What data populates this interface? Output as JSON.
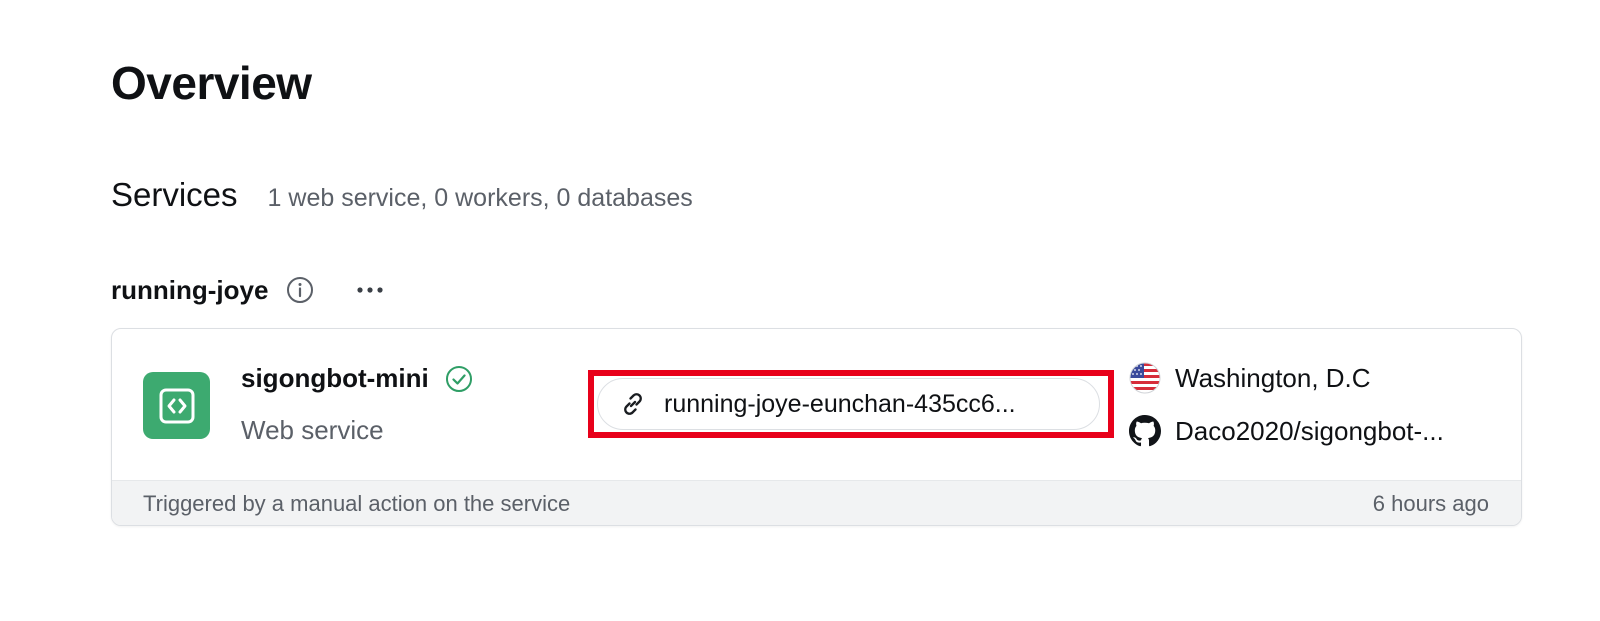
{
  "page": {
    "title": "Overview"
  },
  "services": {
    "title": "Services",
    "summary": "1 web service, 0 workers, 0 databases"
  },
  "group": {
    "name": "running-joye",
    "info_icon": "info-icon",
    "more_icon": "more-options-icon"
  },
  "service": {
    "name": "sigongbot-mini",
    "status_icon": "check-circle-icon",
    "type": "Web service",
    "url": "running-joye-eunchan-435cc6...",
    "region": "Washington, D.C",
    "repo": "Daco2020/sigongbot-...",
    "footer": {
      "trigger": "Triggered by a manual action on the service",
      "time": "6 hours ago"
    }
  },
  "colors": {
    "service_logo_bg": "#3daa70",
    "status_ok": "#2f9e66",
    "highlight": "#e8001a",
    "footer_bg": "#f2f3f4",
    "muted_text": "#5b6068"
  }
}
